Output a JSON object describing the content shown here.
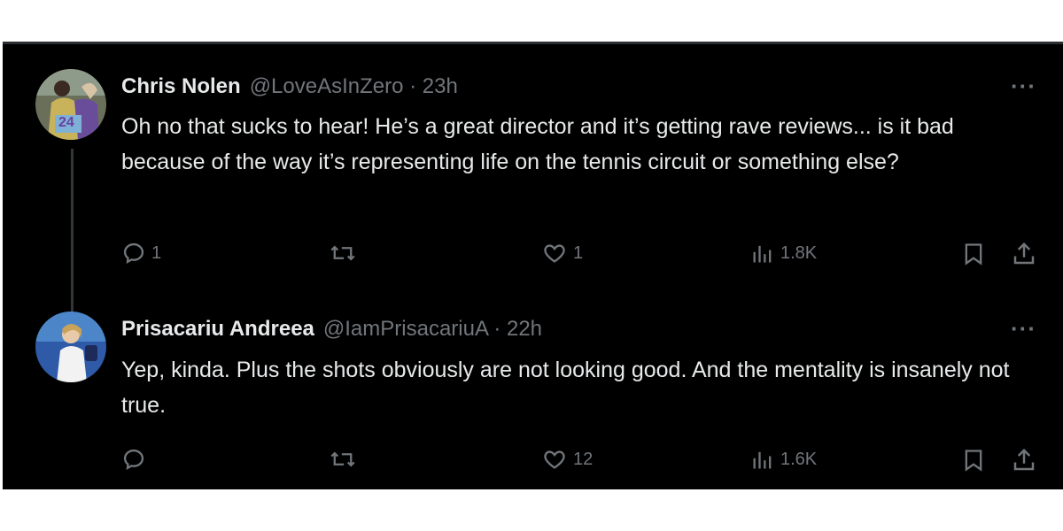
{
  "tweets": [
    {
      "name": "Chris Nolen",
      "handle": "@LoveAsInZero · 23h",
      "text": "Oh no that sucks to hear! He’s a great director and it’s getting rave reviews... is it bad because of the way it’s representing life on the tennis circuit or something else?",
      "avatar_badge": "24",
      "replies": "1",
      "reposts": "",
      "likes": "1",
      "views": "1.8K"
    },
    {
      "name": "Prisacariu Andreea",
      "handle": "@IamPrisacariuA · 22h",
      "text": "Yep, kinda. Plus the shots obviously are not looking good. And the mentality is insanely not true.",
      "replies": "",
      "reposts": "",
      "likes": "12",
      "views": "1.6K"
    }
  ],
  "more_label": "···",
  "icons": [
    "reply-icon",
    "repost-icon",
    "like-icon",
    "views-icon",
    "bookmark-icon",
    "share-icon",
    "more-icon"
  ],
  "colors": {
    "background": "#000000",
    "text": "#e7e9ea",
    "muted": "#71767b",
    "line": "#333639"
  }
}
